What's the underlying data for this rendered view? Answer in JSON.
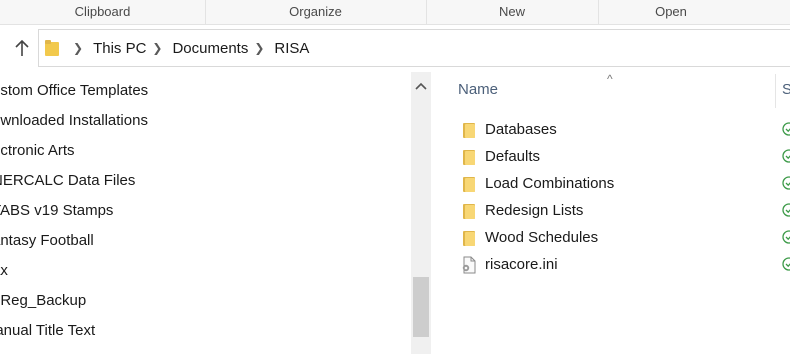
{
  "ribbon": {
    "groups": [
      "Clipboard",
      "Organize",
      "New",
      "Open"
    ]
  },
  "address": {
    "crumbs": [
      "This PC",
      "Documents",
      "RISA"
    ]
  },
  "nav": {
    "items": [
      "ustom Office Templates",
      "ownloaded Installations",
      "ectronic Arts",
      "NERCALC Data Files",
      "TABS v19 Stamps",
      "antasy Football",
      "ax",
      "pReg_Backup",
      "lanual Title Text"
    ]
  },
  "list": {
    "name_header": "Name",
    "second_header": "S",
    "files": [
      {
        "name": "Databases",
        "type": "folder"
      },
      {
        "name": "Defaults",
        "type": "folder"
      },
      {
        "name": "Load Combinations",
        "type": "folder"
      },
      {
        "name": "Redesign Lists",
        "type": "folder"
      },
      {
        "name": "Wood Schedules",
        "type": "folder"
      },
      {
        "name": "risacore.ini",
        "type": "ini-file"
      }
    ]
  },
  "colors": {
    "folder_yellow": "#f8d775",
    "folder_dark": "#e0b64a",
    "status_green": "#3c9a48",
    "header_text": "#4c607a"
  },
  "icons": {
    "up": "up-arrow-icon",
    "folder": "folder-icon",
    "sync_status": "sync-ok-icon",
    "ini_file": "settings-file-icon"
  }
}
